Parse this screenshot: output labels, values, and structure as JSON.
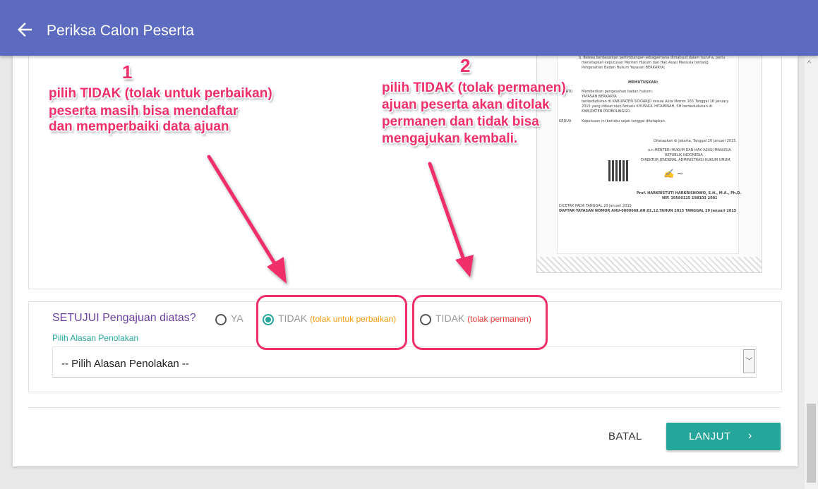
{
  "header": {
    "title": "Periksa Calon Peserta",
    "back_icon": "arrow-left-icon"
  },
  "annotations": [
    {
      "number": "1",
      "lines": [
        "pilih TIDAK (tolak untuk perbaikan)",
        "peserta masih bisa mendaftar",
        "dan memperbaiki data ajuan"
      ]
    },
    {
      "number": "2",
      "lines": [
        "pilih TIDAK (tolak permanen)",
        "ajuan peserta akan ditolak",
        "permanen dan tidak bisa",
        "mengajukan kembali."
      ]
    }
  ],
  "document": {
    "lines": [
      "b. Bahwa berdasarkan pertimbangan sebagaimana dimaksud dalam huruf a, perlu",
      "menetapkan keputusan Menteri Hukum dan Hak Asasi Manusia tentang",
      "Pengesahan Badan Hukum Yayasan BERKARYA;",
      "MEMUTUSKAN:",
      "Memberikan pengesahan badan hukum:",
      "YAYASAN BERKARYA",
      "berkedudukan di KABUPATEN SIDOARJO sesuai Akta Nomor 165 Tanggal 16 January",
      "2015 yang dibuat oleh Notaris KHUSNUL HITAMINAH, SH berkedudukan di",
      "KABUPATEN PROBOLINGGO.",
      "Keputusan ini berlaku sejak tanggal ditetapkan.",
      "Ditetapkan di Jakarta, Tanggal 20 Januari 2015.",
      "a.n MENTERI HUKUM DAN HAK ASASI MANUSIA",
      "REPUBLIK INDONESIA",
      "DIREKTUR JENDERAL ADMINISTRASI HUKUM UMUM,",
      "Prof. HARKRISTUTI HARKRISNOWO, S.H., M.A., Ph.D.",
      "NIP. 19560125 198103 2001",
      "DICETAK PADA TANGGAL 20 Januari 2015",
      "DAFTAR YAYASAN NOMOR AHU-0000668.AH.01.12.TAHUN 2015 TANGGAL 20 Januari 2015"
    ],
    "side_labels": [
      "KESATU",
      "KEDUA"
    ]
  },
  "form": {
    "question": "SETUJUI Pengajuan diatas?",
    "options": [
      {
        "label": "YA",
        "note": "",
        "selected": false
      },
      {
        "label": "TIDAK",
        "note": "(tolak untuk perbaikan)",
        "selected": true
      },
      {
        "label": "TIDAK",
        "note": "(tolak permanen)",
        "selected": false
      }
    ],
    "reason_label": "Pilih Alasan Penolakan",
    "reason_value": "-- Pilih Alasan Penolakan --"
  },
  "actions": {
    "cancel": "BATAL",
    "next": "LANJUT",
    "next_icon": "chevron-right-icon"
  },
  "colors": {
    "header": "#5c6bc0",
    "accent": "#26a69a",
    "annotation": "#ef2f6a"
  }
}
